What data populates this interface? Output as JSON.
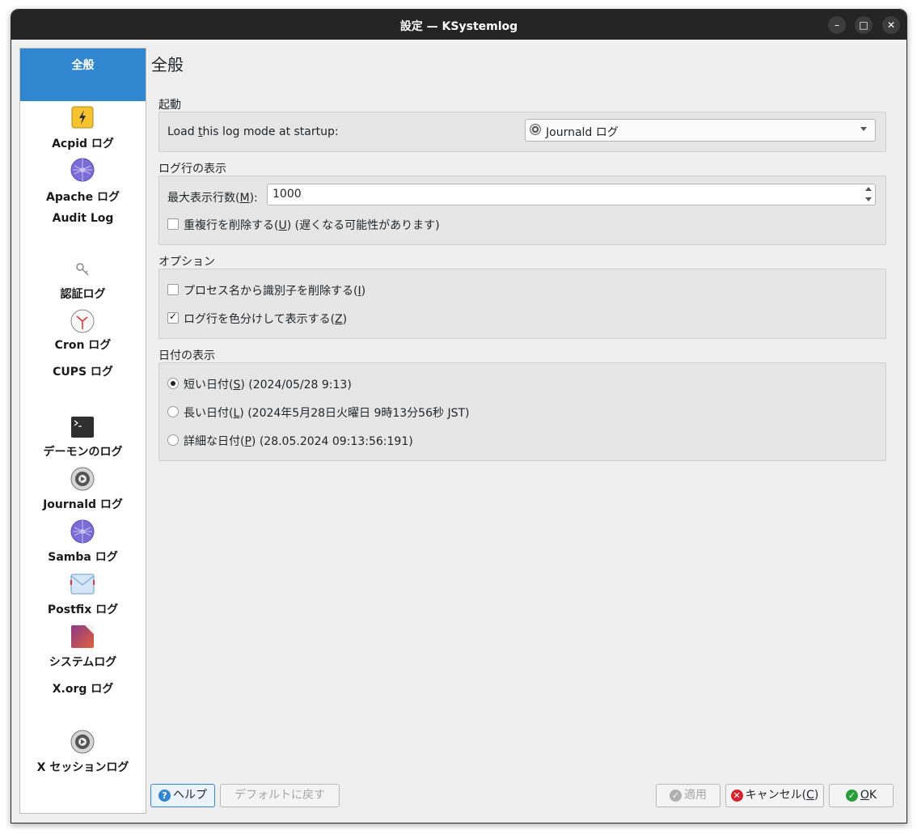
{
  "window": {
    "title": "設定 — KSystemlog"
  },
  "sidebar": {
    "items": [
      {
        "label": "全般",
        "icon": "general-icon"
      },
      {
        "label": "Acpid ログ",
        "icon": "lightning-icon"
      },
      {
        "label": "Apache ログ",
        "icon": "globe-icon"
      },
      {
        "label": "Audit Log",
        "icon": ""
      },
      {
        "label": "認証ログ",
        "icon": "key-icon"
      },
      {
        "label": "Cron ログ",
        "icon": "clock-icon"
      },
      {
        "label": "CUPS ログ",
        "icon": ""
      },
      {
        "label": "デーモンのログ",
        "icon": "terminal-icon"
      },
      {
        "label": "Journald ログ",
        "icon": "gear-icon"
      },
      {
        "label": "Samba ログ",
        "icon": "globe-icon"
      },
      {
        "label": "Postfix ログ",
        "icon": "mail-icon"
      },
      {
        "label": "システムログ",
        "icon": "system-icon"
      },
      {
        "label": "X.org ログ",
        "icon": ""
      },
      {
        "label": "X セッションログ",
        "icon": "gear-icon"
      }
    ]
  },
  "main": {
    "title": "全般",
    "startup": {
      "group_title": "起動",
      "label_pre": "Load ",
      "label_mnemonic": "t",
      "label_post": "his log mode at startup:",
      "combo_value": "Journald ログ"
    },
    "log_lines": {
      "group_title": "ログ行の表示",
      "max_lines_label_pre": "最大表示行数(",
      "max_lines_mnemonic": "M",
      "max_lines_label_post": "):",
      "max_lines_value": "1000",
      "remove_dup_pre": "重複行を削除する(",
      "remove_dup_mnemonic": "U",
      "remove_dup_post": ") (遅くなる可能性があります)",
      "remove_dup_checked": false
    },
    "options": {
      "group_title": "オプション",
      "remove_pid_pre": "プロセス名から識別子を削除する(",
      "remove_pid_mnemonic": "I",
      "remove_pid_post": ")",
      "remove_pid_checked": false,
      "colorize_pre": "ログ行を色分けして表示する(",
      "colorize_mnemonic": "Z",
      "colorize_post": ")",
      "colorize_checked": true
    },
    "date": {
      "group_title": "日付の表示",
      "short_pre": "短い日付(",
      "short_mnemonic": "S",
      "short_post": ") (2024/05/28 9:13)",
      "long_pre": "長い日付(",
      "long_mnemonic": "L",
      "long_post": ") (2024年5月28日火曜日 9時13分56秒 JST)",
      "precise_pre": "詳細な日付(",
      "precise_mnemonic": "P",
      "precise_post": ") (28.05.2024 09:13:56:191)",
      "selected": "short"
    }
  },
  "buttons": {
    "help": "ヘルプ",
    "defaults": "デフォルトに戻す",
    "apply": "適用",
    "cancel_pre": "キャンセル(",
    "cancel_mnemonic": "C",
    "cancel_post": ")",
    "ok_mnemonic": "O",
    "ok_post": "K"
  },
  "colors": {
    "accent": "#3087d0",
    "titlebar": "#242424"
  }
}
